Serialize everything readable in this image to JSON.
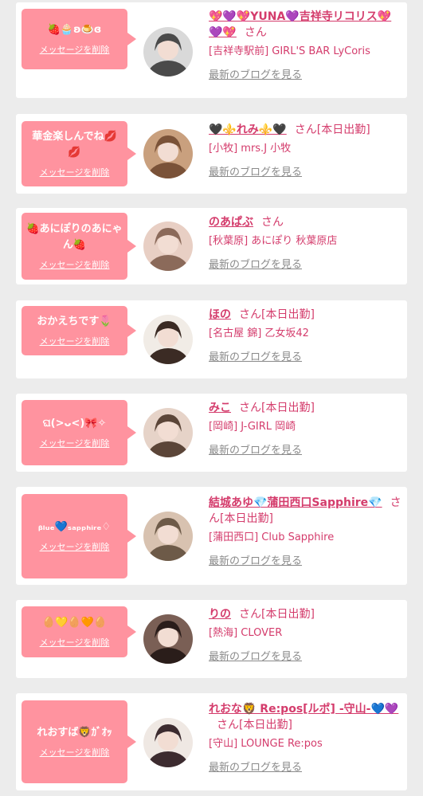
{
  "cards": [
    {
      "message": "🍓🧁ʚ🍮ɞ",
      "delete_label": "メッセージを削除",
      "name": "💖💜💖YUNA💜吉祥寺リコリス💖💜💖",
      "san": "さん",
      "status": "",
      "shop": "[吉祥寺駅前] GIRL'S BAR LyCoris",
      "blog_label": "最新のブログを見る",
      "avatar_colors": [
        "#d9d9d9",
        "#4a4a4a"
      ]
    },
    {
      "message": "華金楽しんでね💋💋",
      "delete_label": "メッセージを削除",
      "name": "🖤⚜️れみ⚜️🖤",
      "san": "さん",
      "status": "[本日出勤]",
      "shop": "[小牧] mrs.J 小牧",
      "blog_label": "最新のブログを見る",
      "avatar_colors": [
        "#c9a07e",
        "#7a5238"
      ]
    },
    {
      "message": "🍓あにぽりのあにゃん🍓",
      "delete_label": "メッセージを削除",
      "name": "のあぱぶ",
      "san": "さん",
      "status": "",
      "shop": "[秋葉原] あにぽり 秋葉原店",
      "blog_label": "最新のブログを見る",
      "avatar_colors": [
        "#e8cfc4",
        "#8b6a5a"
      ]
    },
    {
      "message": "おかえちです🌷",
      "delete_label": "メッセージを削除",
      "name": "ほの",
      "san": "さん",
      "status": "[本日出勤]",
      "shop": "[名古屋 錦] 乙女坂42",
      "blog_label": "最新のブログを見る",
      "avatar_colors": [
        "#f1ece6",
        "#3b2b24"
      ]
    },
    {
      "message": "ଘ(>ᴗ<)🎀✧",
      "delete_label": "メッセージを削除",
      "name": "みこ",
      "san": "さん",
      "status": "[本日出勤]",
      "shop": "[岡崎] J-GIRL 岡崎",
      "blog_label": "最新のブログを見る",
      "avatar_colors": [
        "#e6d3c8",
        "#5b4538"
      ]
    },
    {
      "message": "ᵦₗᵤₑ💙ₛₐₚₚₕᵢᵣₑ♢",
      "delete_label": "メッセージを削除",
      "name": "結城あゆ💎蒲田西口Sapphire💎",
      "san": "さん",
      "status": "[本日出勤]",
      "shop": "[蒲田西口] Club Sapphire",
      "blog_label": "最新のブログを見る",
      "avatar_colors": [
        "#d8c2b0",
        "#6d5a48"
      ]
    },
    {
      "message": "🥚💛🥚🧡🥚",
      "delete_label": "メッセージを削除",
      "name": "りの",
      "san": "さん",
      "status": "[本日出勤]",
      "shop": "[熱海] CLOVER",
      "blog_label": "最新のブログを見る",
      "avatar_colors": [
        "#7a5f55",
        "#2a1d1a"
      ]
    },
    {
      "message": "れおすば🦁ｶﾞｵｯ",
      "delete_label": "メッセージを削除",
      "name": "れおな🦁 Re:pos[ルポ] -守山-💙💜",
      "san": "さん",
      "status": "[本日出勤]",
      "shop": "[守山] LOUNGE Re:pos",
      "blog_label": "最新のブログを見る",
      "avatar_colors": [
        "#efe8e3",
        "#3c2b2f"
      ]
    }
  ]
}
